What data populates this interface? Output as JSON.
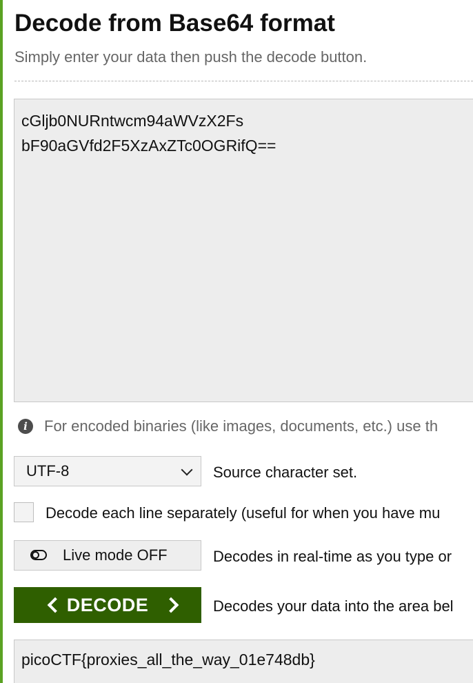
{
  "page": {
    "title": "Decode from Base64 format",
    "subtitle": "Simply enter your data then push the decode button."
  },
  "input": {
    "lines": [
      "cGljb0NURntwcm94aWVzX2Fs",
      "bF90aGVfd2F5XzAxZTc0OGRifQ=="
    ]
  },
  "info": {
    "icon": "info-icon",
    "text": "For encoded binaries (like images, documents, etc.) use th"
  },
  "charset": {
    "selected": "UTF-8",
    "label": "Source character set."
  },
  "line_option": {
    "checked": false,
    "label": "Decode each line separately (useful for when you have mu"
  },
  "live_mode": {
    "label": "Live mode OFF",
    "description": "Decodes in real-time as you type or"
  },
  "decode": {
    "label": "DECODE",
    "description": "Decodes your data into the area bel"
  },
  "output": {
    "text": "picoCTF{proxies_all_the_way_01e748db}"
  },
  "colors": {
    "accent_green": "#5aa222",
    "decode_button": "#2f5f00",
    "field_background": "#ededed"
  }
}
